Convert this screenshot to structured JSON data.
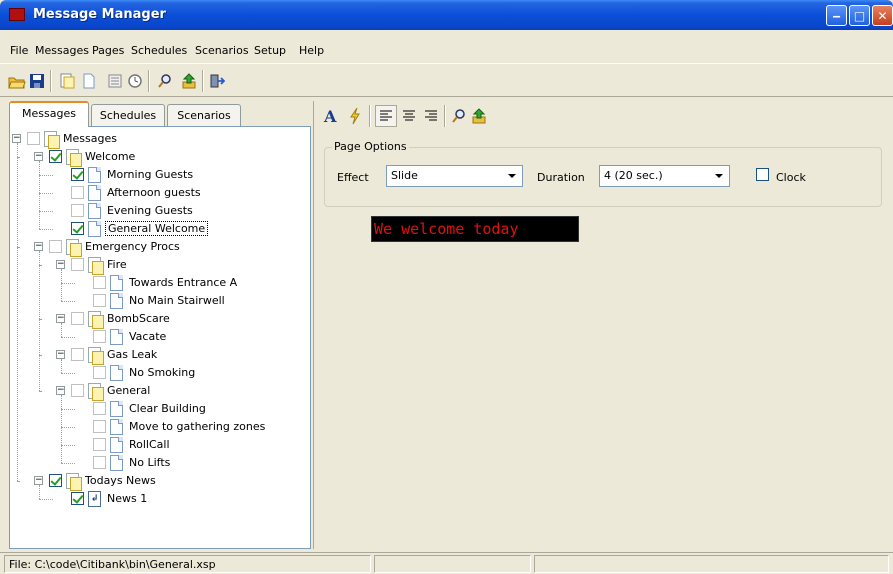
{
  "window": {
    "title": "Message Manager"
  },
  "menu": [
    "File",
    "Messages",
    "Pages",
    "Schedules",
    "Scenarios",
    "Setup",
    "Help"
  ],
  "toolbar_icons": [
    "open-folder-icon",
    "save-icon",
    "new-folder-icon",
    "new-page-icon",
    "properties-icon",
    "clock-icon",
    "search-icon",
    "upload-icon",
    "exit-icon"
  ],
  "tabs": [
    "Messages",
    "Schedules",
    "Scenarios"
  ],
  "tree": [
    {
      "label": "Messages",
      "checked": false,
      "icon": "folder"
    },
    {
      "label": "Welcome",
      "checked": true,
      "icon": "folder"
    },
    {
      "label": "Morning Guests",
      "checked": true,
      "icon": "page"
    },
    {
      "label": "Afternoon guests",
      "checked": false,
      "icon": "page"
    },
    {
      "label": "Evening Guests",
      "checked": false,
      "icon": "page"
    },
    {
      "label": "General Welcome",
      "checked": true,
      "icon": "page",
      "selected": true
    },
    {
      "label": "Emergency Procs",
      "checked": false,
      "icon": "folder"
    },
    {
      "label": "Fire",
      "checked": false,
      "icon": "folder"
    },
    {
      "label": "Towards Entrance A",
      "checked": false,
      "icon": "page"
    },
    {
      "label": "No Main Stairwell",
      "checked": false,
      "icon": "page"
    },
    {
      "label": "BombScare",
      "checked": false,
      "icon": "folder"
    },
    {
      "label": "Vacate",
      "checked": false,
      "icon": "page"
    },
    {
      "label": "Gas Leak",
      "checked": false,
      "icon": "folder"
    },
    {
      "label": "No Smoking",
      "checked": false,
      "icon": "page"
    },
    {
      "label": "General",
      "checked": false,
      "icon": "folder"
    },
    {
      "label": "Clear Building",
      "checked": false,
      "icon": "page"
    },
    {
      "label": "Move to gathering zones",
      "checked": false,
      "icon": "page"
    },
    {
      "label": "RollCall",
      "checked": false,
      "icon": "page"
    },
    {
      "label": "No Lifts",
      "checked": false,
      "icon": "page"
    },
    {
      "label": "Todays News",
      "checked": true,
      "icon": "folder"
    },
    {
      "label": "News 1",
      "checked": true,
      "icon": "news"
    }
  ],
  "right_toolbar_icons": [
    "font-icon",
    "effect-lightning-icon",
    "align-left-icon",
    "align-center-icon",
    "align-right-icon",
    "search-icon",
    "upload-icon"
  ],
  "page_options": {
    "legend": "Page Options",
    "effect_label": "Effect",
    "effect_value": "Slide",
    "duration_label": "Duration",
    "duration_value": "4 (20 sec.)",
    "clock_label": "Clock",
    "clock_checked": false
  },
  "preview": {
    "text": "We welcome today",
    "color": "#E01010",
    "background": "#000000"
  },
  "status": {
    "file": "File: C:\\code\\Citibank\\bin\\General.xsp"
  }
}
